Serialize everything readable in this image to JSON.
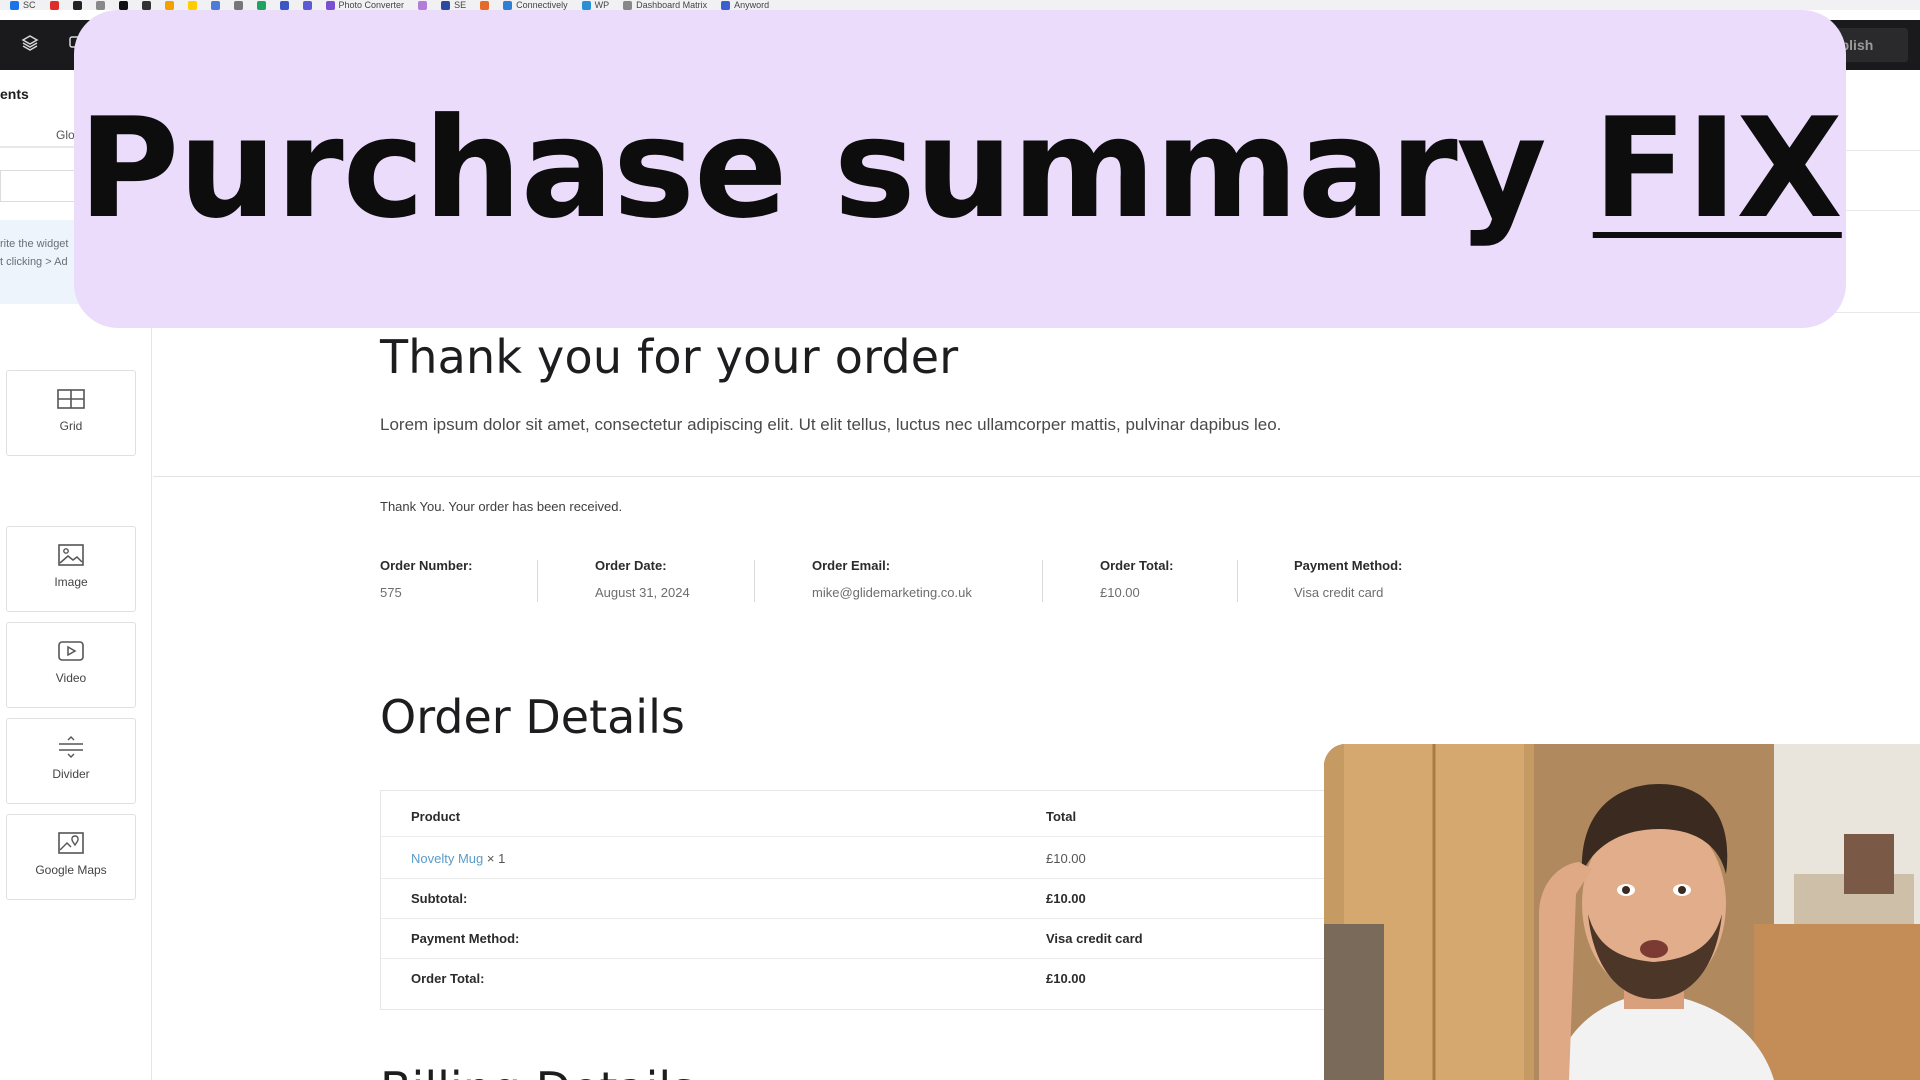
{
  "bookmarks": [
    {
      "label": "SC",
      "color": "#1a73e8"
    },
    {
      "label": "",
      "color": "#e02b2b"
    },
    {
      "label": "",
      "color": "#222222"
    },
    {
      "label": "",
      "color": "#888888"
    },
    {
      "label": "",
      "color": "#111111"
    },
    {
      "label": "",
      "color": "#333333"
    },
    {
      "label": "",
      "color": "#f4a100"
    },
    {
      "label": "",
      "color": "#ffcc00"
    },
    {
      "label": "",
      "color": "#4e7bd9"
    },
    {
      "label": "",
      "color": "#777777"
    },
    {
      "label": "",
      "color": "#1ea362"
    },
    {
      "label": "",
      "color": "#3a57c4"
    },
    {
      "label": "",
      "color": "#5b5bd6"
    },
    {
      "label": "Photo Converter",
      "color": "#7a4fd1"
    },
    {
      "label": "",
      "color": "#b57bd8"
    },
    {
      "label": "SE",
      "color": "#2b4aa0"
    },
    {
      "label": "",
      "color": "#e46a2a"
    },
    {
      "label": "Connectively",
      "color": "#2f7fd6"
    },
    {
      "label": "WP",
      "color": "#2b8fd6"
    },
    {
      "label": "Dashboard Matrix",
      "color": "#888888"
    },
    {
      "label": "Anyword",
      "color": "#3b5ed1"
    }
  ],
  "editor": {
    "publish_label": "Publish"
  },
  "left_panel": {
    "title": "ents",
    "tab_label": "Glo",
    "notice_line1": "rite the widget",
    "notice_line2": "t clicking > Ad",
    "widgets": [
      {
        "label": "Grid"
      },
      {
        "label": "Image"
      },
      {
        "label": "Video"
      },
      {
        "label": "Divider"
      },
      {
        "label": "Google Maps"
      }
    ],
    "collapse_glyph": "‹"
  },
  "banner": {
    "title_main": "Purchase summary ",
    "title_emphasis": "FIX",
    "background": "#ebdcfb"
  },
  "page": {
    "thanks_title": "Thank you for your order",
    "lorem": "Lorem ipsum dolor sit amet, consectetur adipiscing elit. Ut elit tellus, luctus nec ullamcorper mattis, pulvinar dapibus leo.",
    "received": "Thank You. Your order has been received.",
    "overview": [
      {
        "label": "Order Number:",
        "value": "575"
      },
      {
        "label": "Order Date:",
        "value": "August 31, 2024"
      },
      {
        "label": "Order Email:",
        "value": "mike@glidemarketing.co.uk"
      },
      {
        "label": "Order Total:",
        "value": "£10.00"
      },
      {
        "label": "Payment Method:",
        "value": "Visa credit card"
      }
    ],
    "order_details_title": "Order Details",
    "table": {
      "header_product": "Product",
      "header_total": "Total",
      "item_name": "Novelty Mug",
      "item_qty": "× 1",
      "item_total": "£10.00",
      "subtotal_label": "Subtotal:",
      "subtotal_value": "£10.00",
      "payment_label": "Payment Method:",
      "payment_value": "Visa credit card",
      "total_label": "Order Total:",
      "total_value": "£10.00"
    },
    "next_section_partial": "Billing Details"
  }
}
